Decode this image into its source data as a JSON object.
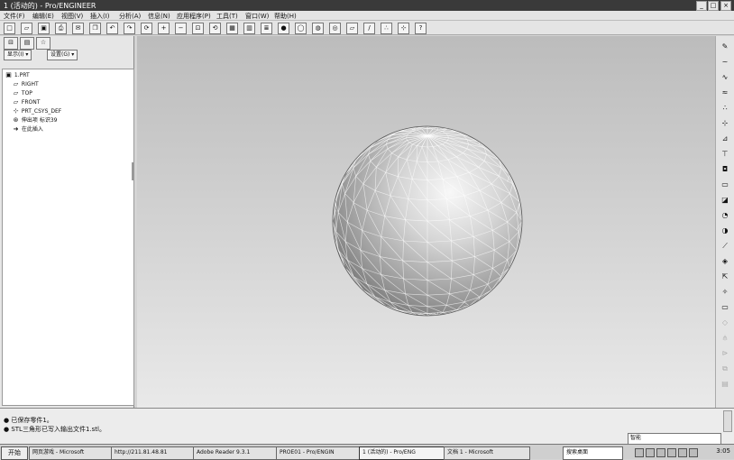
{
  "window": {
    "title": "1 (活动的) - Pro/ENGINEER",
    "buttons": [
      "_",
      "□",
      "×"
    ]
  },
  "menu": [
    "文件(F)",
    "编辑(E)",
    "视图(V)",
    "插入(I)",
    "分析(A)",
    "信息(N)",
    "应用程序(P)",
    "工具(T)",
    "窗口(W)",
    "帮助(H)"
  ],
  "toolbar_icons": [
    "new-icon",
    "open-icon",
    "save-icon",
    "print-icon",
    "email-icon",
    "copy-icon",
    "undo-icon",
    "redo-icon",
    "regenerate-icon",
    "zoom-in-icon",
    "zoom-out-icon",
    "refit-icon",
    "orient-icon",
    "view-manager-icon",
    "saved-view-icon",
    "layers-icon",
    "shading-icon",
    "wireframe-icon",
    "hidden-line-icon",
    "no-hidden-icon",
    "datum-plane-icon",
    "datum-axis-icon",
    "datum-point-icon",
    "csys-icon",
    "context-help-icon"
  ],
  "left_panel": {
    "show_label": "显示(I) ▾",
    "settings_label": "设置(G) ▾",
    "tree": [
      {
        "icon": "part-icon",
        "label": "1.PRT"
      },
      {
        "icon": "datum-plane-icon",
        "label": "RIGHT"
      },
      {
        "icon": "datum-plane-icon",
        "label": "TOP"
      },
      {
        "icon": "datum-plane-icon",
        "label": "FRONT"
      },
      {
        "icon": "csys-icon",
        "label": "PRT_CSYS_DEF"
      },
      {
        "icon": "revolve-icon",
        "label": "伸出项 标识39"
      },
      {
        "icon": "insert-arrow-icon",
        "label": "在此插入"
      }
    ]
  },
  "messages": [
    "● 已保存零件1。",
    "● STL三角形已写入输出文件1.stl。"
  ],
  "filter": {
    "value": "智能"
  },
  "taskbar": {
    "start": "开始",
    "tasks": [
      {
        "label": "网页游戏 - Microsoft",
        "active": false
      },
      {
        "label": "http://211.81.48.81",
        "active": false
      },
      {
        "label": "Adobe Reader 9.3.1",
        "active": false
      },
      {
        "label": "PROE01 - Pro/ENGIN",
        "active": false
      },
      {
        "label": "1 (活动的) - Pro/ENG",
        "active": true
      },
      {
        "label": "文档 1 - Microsoft",
        "active": false
      }
    ],
    "search_placeholder": "搜索桌面",
    "clock": "3:05"
  }
}
